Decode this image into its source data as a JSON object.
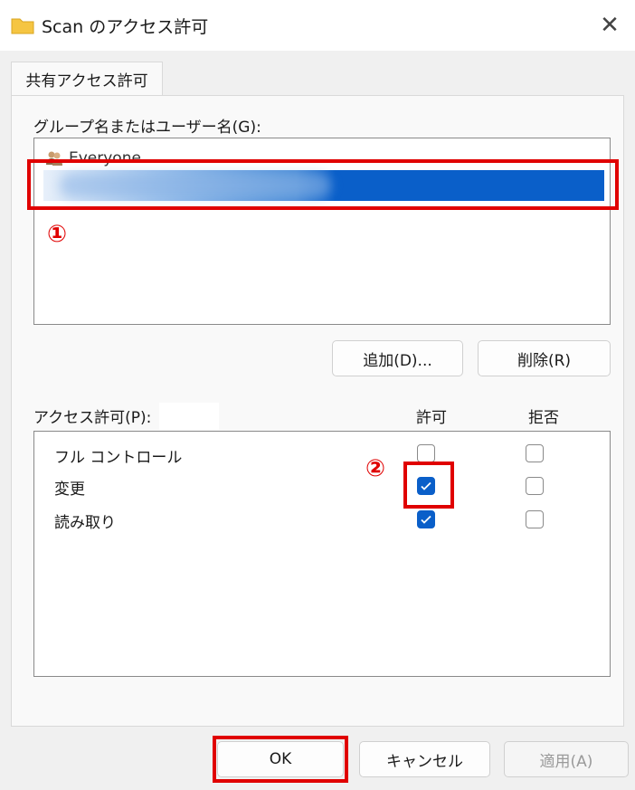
{
  "window": {
    "title": "Scan のアクセス許可",
    "close_glyph": "✕"
  },
  "tabs": [
    {
      "label": "共有アクセス許可"
    }
  ],
  "group_section": {
    "label": "グループ名またはユーザー名(G):",
    "items": [
      {
        "name": "Everyone"
      }
    ],
    "annotation": "①"
  },
  "group_buttons": {
    "add": "追加(D)...",
    "remove": "削除(R)"
  },
  "permissions": {
    "label": "アクセス許可(P):",
    "allow_header": "許可",
    "deny_header": "拒否",
    "rows": [
      {
        "label": "フル コントロール",
        "allow": false,
        "deny": false
      },
      {
        "label": "変更",
        "allow": true,
        "deny": false
      },
      {
        "label": "読み取り",
        "allow": true,
        "deny": false
      }
    ],
    "annotation": "②"
  },
  "footer_buttons": {
    "ok": "OK",
    "cancel": "キャンセル",
    "apply": "適用(A)"
  },
  "colors": {
    "accent": "#0a5fc9",
    "highlight": "#e00000",
    "background": "#f0f0f0"
  }
}
